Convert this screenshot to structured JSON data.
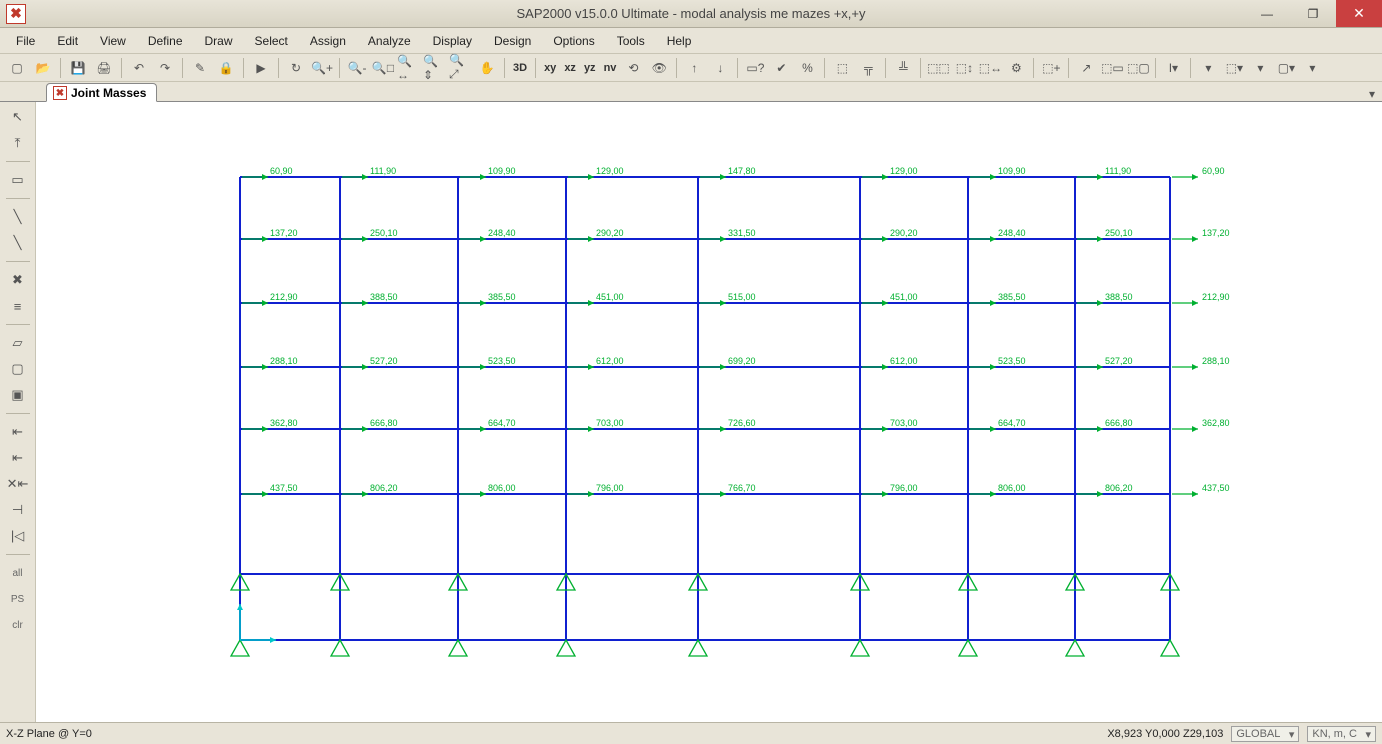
{
  "window": {
    "title": "SAP2000 v15.0.0 Ultimate  - modal analysis me mazes +x,+y"
  },
  "menu": {
    "items": [
      "File",
      "Edit",
      "View",
      "Define",
      "Draw",
      "Select",
      "Assign",
      "Analyze",
      "Display",
      "Design",
      "Options",
      "Tools",
      "Help"
    ]
  },
  "toolbar_glyphs": {
    "row1": [
      "▢",
      "📂",
      "💾",
      "🖨",
      "↶",
      "↷",
      "✎",
      "🔒",
      "▶",
      "↻",
      "🔍+",
      "🔍-",
      "🔍□",
      "🔍↔",
      "🔍⇕",
      "🔍⤢",
      "✋",
      "3D",
      "xy",
      "xz",
      "yz",
      "nv",
      "⟲",
      "👁",
      "↑",
      "↓",
      "▭?",
      "✔",
      "%",
      "⬚",
      "╦",
      "╩",
      "⬚⬚",
      "⬚↕",
      "⬚↔",
      "⚙",
      "⬚+",
      "↗",
      "⬚▭",
      "⬚▢",
      "I▾",
      "▾",
      "⬚▾",
      "▾",
      "▢▾",
      "▾"
    ]
  },
  "tab": {
    "label": "Joint Masses"
  },
  "grid": {
    "xcols": [
      240,
      340,
      458,
      566,
      698,
      860,
      968,
      1075,
      1170
    ],
    "yrows": [
      177,
      239,
      303,
      367,
      429,
      494,
      574,
      640
    ],
    "masses": [
      [
        "60,90",
        "111,90",
        "109,90",
        "129,00",
        "147,80",
        "129,00",
        "109,90",
        "111,90",
        "60,90"
      ],
      [
        "137,20",
        "250,10",
        "248,40",
        "290,20",
        "331,50",
        "290,20",
        "248,40",
        "250,10",
        "137,20"
      ],
      [
        "212,90",
        "388,50",
        "385,50",
        "451,00",
        "515,00",
        "451,00",
        "385,50",
        "388,50",
        "212,90"
      ],
      [
        "288,10",
        "527,20",
        "523,50",
        "612,00",
        "699,20",
        "612,00",
        "523,50",
        "527,20",
        "288,10"
      ],
      [
        "362,80",
        "666,80",
        "664,70",
        "703,00",
        "726,60",
        "703,00",
        "664,70",
        "666,80",
        "362,80"
      ],
      [
        "437,50",
        "806,20",
        "806,00",
        "796,00",
        "766,70",
        "796,00",
        "806,00",
        "806,20",
        "437,50"
      ]
    ]
  },
  "status": {
    "left": "X-Z Plane @ Y=0",
    "coords": "X8,923  Y0,000  Z29,103",
    "system": "GLOBAL",
    "units": "KN, m, C"
  },
  "left_tools": [
    "↖",
    "⤒",
    "▭",
    "╲",
    "╲",
    "✖",
    "≡",
    "▱",
    "▢",
    "▣",
    "⇤",
    "⇤",
    "✕⇤",
    "⊣",
    "|◁"
  ],
  "left_texts": [
    "all",
    "PS",
    "clr"
  ]
}
